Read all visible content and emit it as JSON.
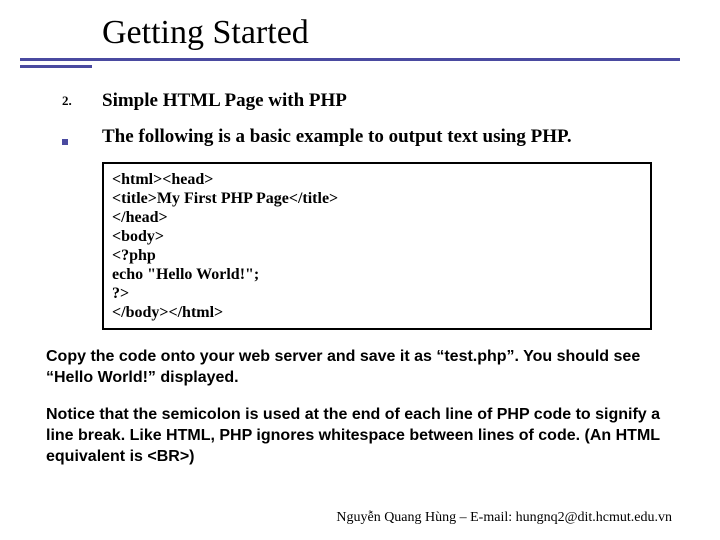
{
  "title": "Getting Started",
  "item_number": "2.",
  "item_heading": "Simple HTML Page with PHP",
  "item_desc": "The following is a basic example to output text using PHP.",
  "code": {
    "l1": "<html><head>",
    "l2": "<title>My First PHP Page</title>",
    "l3": "</head>",
    "l4": "<body>",
    "l5": "<?php",
    "l6": "echo \"Hello World!\";",
    "l7": "?>",
    "l8": "</body></html>"
  },
  "para1": "Copy the code onto your web server and save it as “test.php”. You should see “Hello World!” displayed.",
  "para2": "Notice that the semicolon is used at the end of each line of PHP code to signify a line break. Like HTML, PHP ignores whitespace between lines of code. (An HTML equivalent is <BR>)",
  "footer": "Nguyễn Quang Hùng – E-mail: hungnq2@dit.hcmut.edu.vn"
}
